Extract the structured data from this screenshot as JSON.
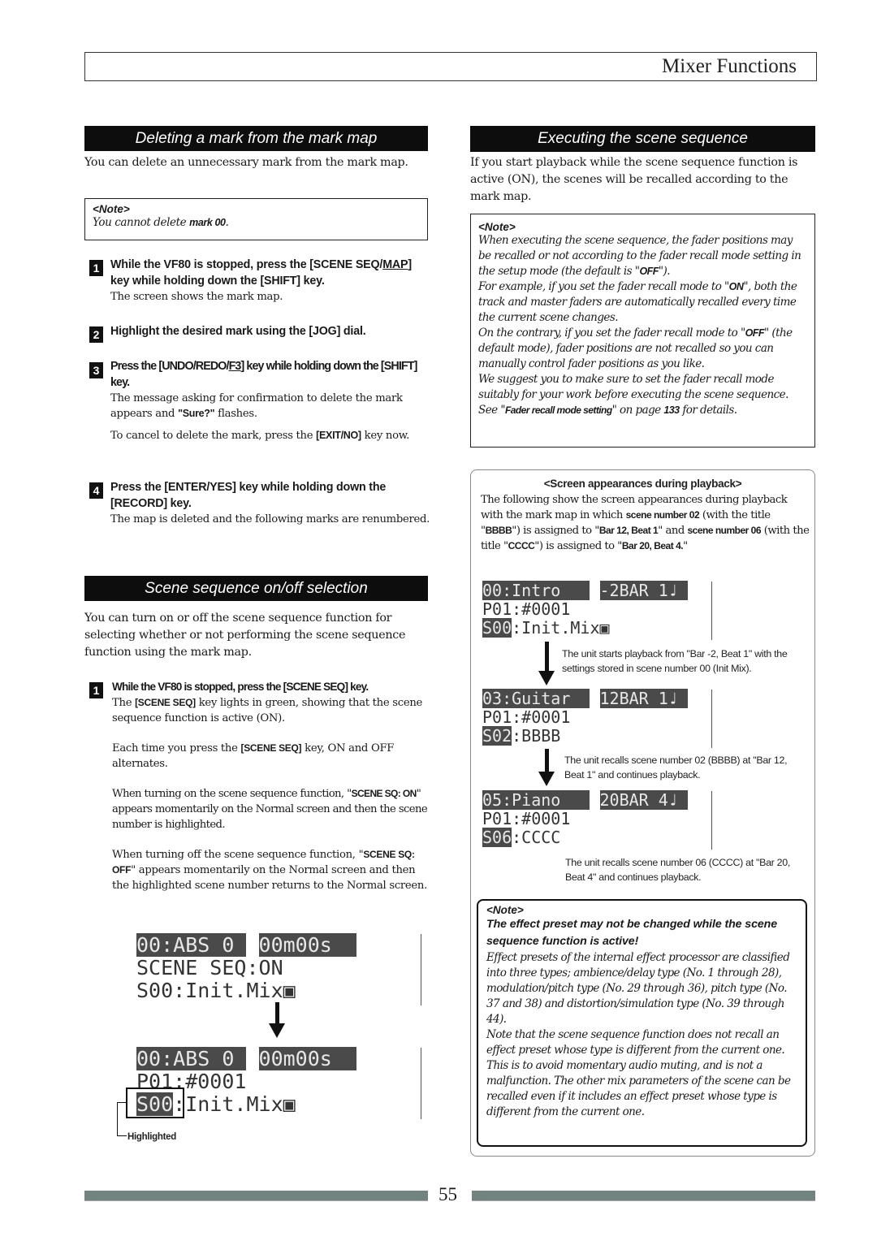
{
  "header": {
    "title": "Mixer Functions"
  },
  "left": {
    "delete_section": {
      "heading": "Deleting a mark from the mark map",
      "intro": "You can delete an unnecessary mark from the mark map.",
      "note": {
        "label": "<Note>",
        "text_pre": "You cannot delete ",
        "text_bold": "mark 00",
        "text_post": "."
      },
      "steps": [
        {
          "num": "1",
          "title_pre": "While the VF80 is stopped, press the [SCENE SEQ/",
          "title_u": "MAP",
          "title_post": "] key while holding down the [SHIFT] key.",
          "body": "The screen shows the mark map."
        },
        {
          "num": "2",
          "title": "Highlight the desired mark using the [JOG] dial."
        },
        {
          "num": "3",
          "title_pre": "Press the [UNDO/REDO/",
          "title_u": "F3",
          "title_post": "] key while holding down the [SHIFT] key.",
          "body1_pre": "The message asking for confirmation to delete the mark appears and ",
          "body1_bold": "\"Sure?\"",
          "body1_post": " flashes.",
          "body2_pre": "To cancel to delete the mark, press the ",
          "body2_bold": "[EXIT/NO]",
          "body2_post": " key now."
        },
        {
          "num": "4",
          "title": "Press the [ENTER/YES] key while holding down the [RECORD] key.",
          "body": "The map is deleted and the following marks are renumbered."
        }
      ]
    },
    "onoff_section": {
      "heading": "Scene sequence on/off selection",
      "intro": "You can turn on or off the scene sequence function for selecting whether or not performing the scene sequence function using the mark map.",
      "step": {
        "num": "1",
        "title": "While the VF80 is stopped, press the [SCENE SEQ] key.",
        "p1_pre": "The ",
        "p1_bold": "[SCENE SEQ]",
        "p1_post": " key lights in green, showing that the scene sequence function is active (ON).",
        "p2_pre": "Each time you press the ",
        "p2_bold": "[SCENE SEQ]",
        "p2_post": " key, ON and OFF alternates.",
        "p3_pre": "When turning on the scene sequence function, \"",
        "p3_bold": "SCENE SQ: ON",
        "p3_post": "\" appears momentarily on the Normal screen and then the scene number is highlighted.",
        "p4_pre": "When turning off the scene sequence function, \"",
        "p4_bold": "SCENE SQ: OFF",
        "p4_post": "\" appears momentarily on the Normal screen and then the highlighted scene number returns to the Normal screen."
      },
      "lcd1": {
        "r1a": "00:ABS 0 ",
        "r1b": "00m00s  ",
        "r2": "SCENE SEQ:ON",
        "r3a": "S00",
        "r3b": ":Init.Mix▣"
      },
      "lcd2": {
        "r1a": "00:ABS 0 ",
        "r1b": "00m00s  ",
        "r2": "P01:#0001",
        "r3a": "S00",
        "r3b": ":Init.Mix▣"
      },
      "highlight_label": "Highlighted"
    }
  },
  "right": {
    "exec_section": {
      "heading": "Executing the scene sequence",
      "intro": "If you start playback while the scene sequence function is active (ON), the scenes will be recalled according to the mark map.",
      "note": {
        "label": "<Note>",
        "p1_pre": "When executing the scene sequence, the fader positions may be recalled or not according to the fader recall mode setting in the setup mode (the default is \"",
        "p1_bold": "OFF",
        "p1_post": "\").",
        "p2_pre": "For example, if you set the fader recall mode to \"",
        "p2_bold": "ON",
        "p2_post": "\", both the track and master faders are automatically recalled every time the current scene changes.",
        "p3_pre": "On the contrary, if you set the fader recall mode to \"",
        "p3_bold": "OFF",
        "p3_post": "\" (the default mode), fader positions are not recalled so you can manually control fader positions as you like.",
        "p4_pre": "We suggest you to make sure to set the fader recall mode suitably for your work before executing the scene sequence. See \"",
        "p4_bold": "Fader recall mode setting",
        "p4_mid": "\" on page ",
        "p4_bold2": "133",
        "p4_post": " for details."
      }
    },
    "playback_box": {
      "title": "<Screen appearances during playback>",
      "intro_parts": [
        {
          "t": "The following show the screen appearances during playback with the mark map in which ",
          "b": false
        },
        {
          "t": "scene number 02",
          "b": true
        },
        {
          "t": " (with the title \"",
          "b": false
        },
        {
          "t": "BBBB",
          "b": true
        },
        {
          "t": "\") is assigned to \"",
          "b": false
        },
        {
          "t": "Bar 12, Beat 1",
          "b": true
        },
        {
          "t": "\" and ",
          "b": false
        },
        {
          "t": "scene number 06",
          "b": true
        },
        {
          "t": " (with the title \"",
          "b": false
        },
        {
          "t": "CCCC",
          "b": true
        },
        {
          "t": "\") is assigned to \"",
          "b": false
        },
        {
          "t": "Bar 20, Beat 4.",
          "b": true
        },
        {
          "t": "\"",
          "b": false
        }
      ],
      "screens": [
        {
          "r1a": "00:Intro   ",
          "r1b": "-2BAR 1♩ ",
          "r2": "P01:#0001",
          "r3a": "S00",
          "r3b": ":Init.Mix▣",
          "caption": "The unit starts playback from \"Bar -2, Beat 1\" with the settings stored in scene number 00 (Init Mix)."
        },
        {
          "r1a": "03:Guitar  ",
          "r1b": "12BAR 1♩ ",
          "r2": "P01:#0001",
          "r3a": "S02",
          "r3b": ":BBBB",
          "caption": "The unit recalls scene number 02 (BBBB) at \"Bar 12, Beat 1\" and continues playback."
        },
        {
          "r1a": "05:Piano   ",
          "r1b": "20BAR 4♩ ",
          "r2": "P01:#0001",
          "r3a": "S06",
          "r3b": ":CCCC",
          "caption": "The unit recalls scene number 06 (CCCC) at \"Bar 20, Beat 4\" and continues playback."
        }
      ],
      "note": {
        "label": "<Note>",
        "warning": "The effect preset may not be changed while the scene sequence function is active!",
        "p1": "Effect presets of the internal effect processor are classified into three types; ambience/delay type (No. 1 through 28), modulation/pitch type (No. 29 through 36), pitch type (No. 37 and 38) and distortion/simulation type (No. 39 through 44).",
        "p2": "Note that the scene sequence function does not recall an effect preset whose type is different from the current one.  This is to avoid momentary audio muting, and is not a malfunction.  The other mix parameters of the scene can be recalled even if it includes an effect preset whose type is different from the current one."
      }
    }
  },
  "footer": {
    "page_number": "55"
  }
}
